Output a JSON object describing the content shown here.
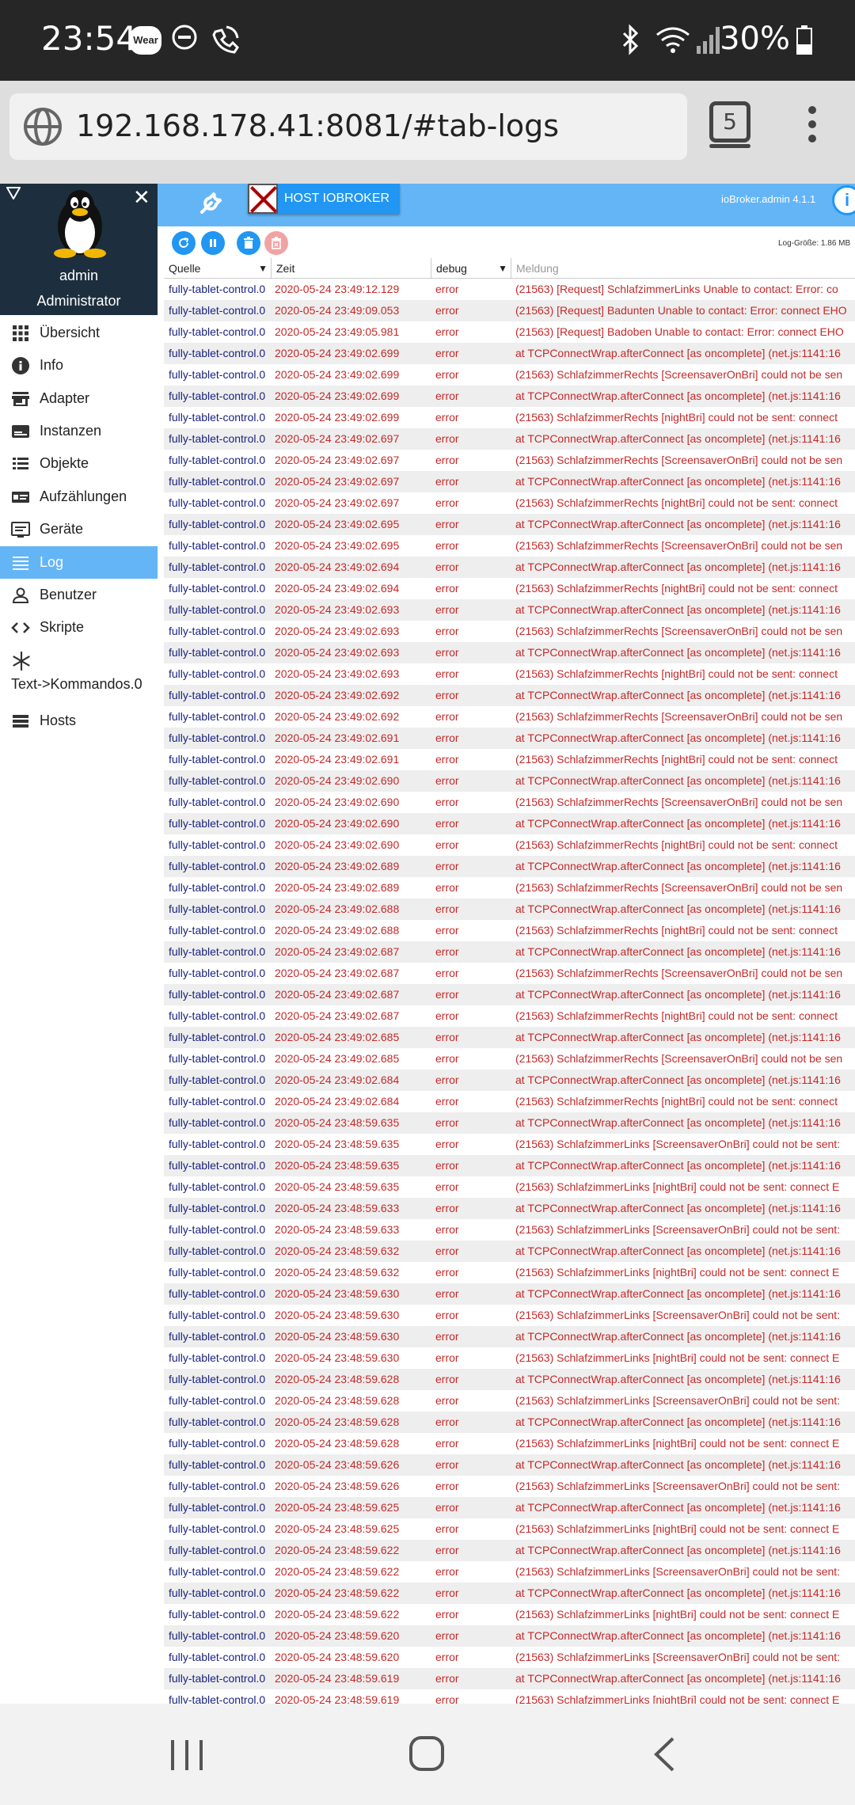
{
  "status_bar": {
    "time": "23:54",
    "wear_badge": "Wear",
    "battery": "30%",
    "icons": [
      "dnd-icon",
      "wifi-calling-icon",
      "bluetooth-icon",
      "wifi-icon",
      "signal-icon",
      "battery-icon"
    ]
  },
  "browser": {
    "url": "192.168.178.41:8081/#tab-logs",
    "tab_count": "5"
  },
  "sidebar": {
    "user_name": "admin",
    "user_role": "Administrator",
    "close_glyph": "✕",
    "items": [
      {
        "label": "Übersicht",
        "icon": "grid-icon"
      },
      {
        "label": "Info",
        "icon": "info-icon"
      },
      {
        "label": "Adapter",
        "icon": "store-icon"
      },
      {
        "label": "Instanzen",
        "icon": "instances-icon"
      },
      {
        "label": "Objekte",
        "icon": "list-icon"
      },
      {
        "label": "Aufzählungen",
        "icon": "enum-icon"
      },
      {
        "label": "Geräte",
        "icon": "devices-icon"
      },
      {
        "label": "Log",
        "icon": "log-icon",
        "active": true
      },
      {
        "label": "Benutzer",
        "icon": "user-icon"
      },
      {
        "label": "Skripte",
        "icon": "code-icon"
      },
      {
        "label": "Text->Kommandos.0",
        "icon": "snowflake-icon"
      },
      {
        "label": "Hosts",
        "icon": "hosts-icon"
      }
    ]
  },
  "topnav": {
    "host_label": "HOST IOBROKER",
    "version": "ioBroker.admin 4.1.1",
    "info_glyph": "i"
  },
  "toolbar": {
    "log_size": "Log-Größe: 1.86 MB"
  },
  "table": {
    "headers": {
      "source": "Quelle",
      "time": "Zeit",
      "severity": "debug",
      "message_placeholder": "Meldung"
    },
    "rows": [
      {
        "source": "fully-tablet-control.0",
        "time": "2020-05-24 23:49:12.129",
        "severity": "error",
        "message": "(21563) [Request] SchlafzimmerLinks Unable to contact: Error: co"
      },
      {
        "source": "fully-tablet-control.0",
        "time": "2020-05-24 23:49:09.053",
        "severity": "error",
        "message": "(21563) [Request] Badunten Unable to contact: Error: connect EHO"
      },
      {
        "source": "fully-tablet-control.0",
        "time": "2020-05-24 23:49:05.981",
        "severity": "error",
        "message": "(21563) [Request] Badoben Unable to contact: Error: connect EHO"
      },
      {
        "source": "fully-tablet-control.0",
        "time": "2020-05-24 23:49:02.699",
        "severity": "error",
        "message": "at TCPConnectWrap.afterConnect [as oncomplete] (net.js:1141:16"
      },
      {
        "source": "fully-tablet-control.0",
        "time": "2020-05-24 23:49:02.699",
        "severity": "error",
        "message": "(21563) SchlafzimmerRechts [ScreensaverOnBri] could not be sen"
      },
      {
        "source": "fully-tablet-control.0",
        "time": "2020-05-24 23:49:02.699",
        "severity": "error",
        "message": "at TCPConnectWrap.afterConnect [as oncomplete] (net.js:1141:16"
      },
      {
        "source": "fully-tablet-control.0",
        "time": "2020-05-24 23:49:02.699",
        "severity": "error",
        "message": "(21563) SchlafzimmerRechts [nightBri] could not be sent: connect"
      },
      {
        "source": "fully-tablet-control.0",
        "time": "2020-05-24 23:49:02.697",
        "severity": "error",
        "message": "at TCPConnectWrap.afterConnect [as oncomplete] (net.js:1141:16"
      },
      {
        "source": "fully-tablet-control.0",
        "time": "2020-05-24 23:49:02.697",
        "severity": "error",
        "message": "(21563) SchlafzimmerRechts [ScreensaverOnBri] could not be sen"
      },
      {
        "source": "fully-tablet-control.0",
        "time": "2020-05-24 23:49:02.697",
        "severity": "error",
        "message": "at TCPConnectWrap.afterConnect [as oncomplete] (net.js:1141:16"
      },
      {
        "source": "fully-tablet-control.0",
        "time": "2020-05-24 23:49:02.697",
        "severity": "error",
        "message": "(21563) SchlafzimmerRechts [nightBri] could not be sent: connect"
      },
      {
        "source": "fully-tablet-control.0",
        "time": "2020-05-24 23:49:02.695",
        "severity": "error",
        "message": "at TCPConnectWrap.afterConnect [as oncomplete] (net.js:1141:16"
      },
      {
        "source": "fully-tablet-control.0",
        "time": "2020-05-24 23:49:02.695",
        "severity": "error",
        "message": "(21563) SchlafzimmerRechts [ScreensaverOnBri] could not be sen"
      },
      {
        "source": "fully-tablet-control.0",
        "time": "2020-05-24 23:49:02.694",
        "severity": "error",
        "message": "at TCPConnectWrap.afterConnect [as oncomplete] (net.js:1141:16"
      },
      {
        "source": "fully-tablet-control.0",
        "time": "2020-05-24 23:49:02.694",
        "severity": "error",
        "message": "(21563) SchlafzimmerRechts [nightBri] could not be sent: connect"
      },
      {
        "source": "fully-tablet-control.0",
        "time": "2020-05-24 23:49:02.693",
        "severity": "error",
        "message": "at TCPConnectWrap.afterConnect [as oncomplete] (net.js:1141:16"
      },
      {
        "source": "fully-tablet-control.0",
        "time": "2020-05-24 23:49:02.693",
        "severity": "error",
        "message": "(21563) SchlafzimmerRechts [ScreensaverOnBri] could not be sen"
      },
      {
        "source": "fully-tablet-control.0",
        "time": "2020-05-24 23:49:02.693",
        "severity": "error",
        "message": "at TCPConnectWrap.afterConnect [as oncomplete] (net.js:1141:16"
      },
      {
        "source": "fully-tablet-control.0",
        "time": "2020-05-24 23:49:02.693",
        "severity": "error",
        "message": "(21563) SchlafzimmerRechts [nightBri] could not be sent: connect"
      },
      {
        "source": "fully-tablet-control.0",
        "time": "2020-05-24 23:49:02.692",
        "severity": "error",
        "message": "at TCPConnectWrap.afterConnect [as oncomplete] (net.js:1141:16"
      },
      {
        "source": "fully-tablet-control.0",
        "time": "2020-05-24 23:49:02.692",
        "severity": "error",
        "message": "(21563) SchlafzimmerRechts [ScreensaverOnBri] could not be sen"
      },
      {
        "source": "fully-tablet-control.0",
        "time": "2020-05-24 23:49:02.691",
        "severity": "error",
        "message": "at TCPConnectWrap.afterConnect [as oncomplete] (net.js:1141:16"
      },
      {
        "source": "fully-tablet-control.0",
        "time": "2020-05-24 23:49:02.691",
        "severity": "error",
        "message": "(21563) SchlafzimmerRechts [nightBri] could not be sent: connect"
      },
      {
        "source": "fully-tablet-control.0",
        "time": "2020-05-24 23:49:02.690",
        "severity": "error",
        "message": "at TCPConnectWrap.afterConnect [as oncomplete] (net.js:1141:16"
      },
      {
        "source": "fully-tablet-control.0",
        "time": "2020-05-24 23:49:02.690",
        "severity": "error",
        "message": "(21563) SchlafzimmerRechts [ScreensaverOnBri] could not be sen"
      },
      {
        "source": "fully-tablet-control.0",
        "time": "2020-05-24 23:49:02.690",
        "severity": "error",
        "message": "at TCPConnectWrap.afterConnect [as oncomplete] (net.js:1141:16"
      },
      {
        "source": "fully-tablet-control.0",
        "time": "2020-05-24 23:49:02.690",
        "severity": "error",
        "message": "(21563) SchlafzimmerRechts [nightBri] could not be sent: connect"
      },
      {
        "source": "fully-tablet-control.0",
        "time": "2020-05-24 23:49:02.689",
        "severity": "error",
        "message": "at TCPConnectWrap.afterConnect [as oncomplete] (net.js:1141:16"
      },
      {
        "source": "fully-tablet-control.0",
        "time": "2020-05-24 23:49:02.689",
        "severity": "error",
        "message": "(21563) SchlafzimmerRechts [ScreensaverOnBri] could not be sen"
      },
      {
        "source": "fully-tablet-control.0",
        "time": "2020-05-24 23:49:02.688",
        "severity": "error",
        "message": "at TCPConnectWrap.afterConnect [as oncomplete] (net.js:1141:16"
      },
      {
        "source": "fully-tablet-control.0",
        "time": "2020-05-24 23:49:02.688",
        "severity": "error",
        "message": "(21563) SchlafzimmerRechts [nightBri] could not be sent: connect"
      },
      {
        "source": "fully-tablet-control.0",
        "time": "2020-05-24 23:49:02.687",
        "severity": "error",
        "message": "at TCPConnectWrap.afterConnect [as oncomplete] (net.js:1141:16"
      },
      {
        "source": "fully-tablet-control.0",
        "time": "2020-05-24 23:49:02.687",
        "severity": "error",
        "message": "(21563) SchlafzimmerRechts [ScreensaverOnBri] could not be sen"
      },
      {
        "source": "fully-tablet-control.0",
        "time": "2020-05-24 23:49:02.687",
        "severity": "error",
        "message": "at TCPConnectWrap.afterConnect [as oncomplete] (net.js:1141:16"
      },
      {
        "source": "fully-tablet-control.0",
        "time": "2020-05-24 23:49:02.687",
        "severity": "error",
        "message": "(21563) SchlafzimmerRechts [nightBri] could not be sent: connect"
      },
      {
        "source": "fully-tablet-control.0",
        "time": "2020-05-24 23:49:02.685",
        "severity": "error",
        "message": "at TCPConnectWrap.afterConnect [as oncomplete] (net.js:1141:16"
      },
      {
        "source": "fully-tablet-control.0",
        "time": "2020-05-24 23:49:02.685",
        "severity": "error",
        "message": "(21563) SchlafzimmerRechts [ScreensaverOnBri] could not be sen"
      },
      {
        "source": "fully-tablet-control.0",
        "time": "2020-05-24 23:49:02.684",
        "severity": "error",
        "message": "at TCPConnectWrap.afterConnect [as oncomplete] (net.js:1141:16"
      },
      {
        "source": "fully-tablet-control.0",
        "time": "2020-05-24 23:49:02.684",
        "severity": "error",
        "message": "(21563) SchlafzimmerRechts [nightBri] could not be sent: connect"
      },
      {
        "source": "fully-tablet-control.0",
        "time": "2020-05-24 23:48:59.635",
        "severity": "error",
        "message": "at TCPConnectWrap.afterConnect [as oncomplete] (net.js:1141:16"
      },
      {
        "source": "fully-tablet-control.0",
        "time": "2020-05-24 23:48:59.635",
        "severity": "error",
        "message": "(21563) SchlafzimmerLinks [ScreensaverOnBri] could not be sent:"
      },
      {
        "source": "fully-tablet-control.0",
        "time": "2020-05-24 23:48:59.635",
        "severity": "error",
        "message": "at TCPConnectWrap.afterConnect [as oncomplete] (net.js:1141:16"
      },
      {
        "source": "fully-tablet-control.0",
        "time": "2020-05-24 23:48:59.635",
        "severity": "error",
        "message": "(21563) SchlafzimmerLinks [nightBri] could not be sent: connect E"
      },
      {
        "source": "fully-tablet-control.0",
        "time": "2020-05-24 23:48:59.633",
        "severity": "error",
        "message": "at TCPConnectWrap.afterConnect [as oncomplete] (net.js:1141:16"
      },
      {
        "source": "fully-tablet-control.0",
        "time": "2020-05-24 23:48:59.633",
        "severity": "error",
        "message": "(21563) SchlafzimmerLinks [ScreensaverOnBri] could not be sent:"
      },
      {
        "source": "fully-tablet-control.0",
        "time": "2020-05-24 23:48:59.632",
        "severity": "error",
        "message": "at TCPConnectWrap.afterConnect [as oncomplete] (net.js:1141:16"
      },
      {
        "source": "fully-tablet-control.0",
        "time": "2020-05-24 23:48:59.632",
        "severity": "error",
        "message": "(21563) SchlafzimmerLinks [nightBri] could not be sent: connect E"
      },
      {
        "source": "fully-tablet-control.0",
        "time": "2020-05-24 23:48:59.630",
        "severity": "error",
        "message": "at TCPConnectWrap.afterConnect [as oncomplete] (net.js:1141:16"
      },
      {
        "source": "fully-tablet-control.0",
        "time": "2020-05-24 23:48:59.630",
        "severity": "error",
        "message": "(21563) SchlafzimmerLinks [ScreensaverOnBri] could not be sent:"
      },
      {
        "source": "fully-tablet-control.0",
        "time": "2020-05-24 23:48:59.630",
        "severity": "error",
        "message": "at TCPConnectWrap.afterConnect [as oncomplete] (net.js:1141:16"
      },
      {
        "source": "fully-tablet-control.0",
        "time": "2020-05-24 23:48:59.630",
        "severity": "error",
        "message": "(21563) SchlafzimmerLinks [nightBri] could not be sent: connect E"
      },
      {
        "source": "fully-tablet-control.0",
        "time": "2020-05-24 23:48:59.628",
        "severity": "error",
        "message": "at TCPConnectWrap.afterConnect [as oncomplete] (net.js:1141:16"
      },
      {
        "source": "fully-tablet-control.0",
        "time": "2020-05-24 23:48:59.628",
        "severity": "error",
        "message": "(21563) SchlafzimmerLinks [ScreensaverOnBri] could not be sent:"
      },
      {
        "source": "fully-tablet-control.0",
        "time": "2020-05-24 23:48:59.628",
        "severity": "error",
        "message": "at TCPConnectWrap.afterConnect [as oncomplete] (net.js:1141:16"
      },
      {
        "source": "fully-tablet-control.0",
        "time": "2020-05-24 23:48:59.628",
        "severity": "error",
        "message": "(21563) SchlafzimmerLinks [nightBri] could not be sent: connect E"
      },
      {
        "source": "fully-tablet-control.0",
        "time": "2020-05-24 23:48:59.626",
        "severity": "error",
        "message": "at TCPConnectWrap.afterConnect [as oncomplete] (net.js:1141:16"
      },
      {
        "source": "fully-tablet-control.0",
        "time": "2020-05-24 23:48:59.626",
        "severity": "error",
        "message": "(21563) SchlafzimmerLinks [ScreensaverOnBri] could not be sent:"
      },
      {
        "source": "fully-tablet-control.0",
        "time": "2020-05-24 23:48:59.625",
        "severity": "error",
        "message": "at TCPConnectWrap.afterConnect [as oncomplete] (net.js:1141:16"
      },
      {
        "source": "fully-tablet-control.0",
        "time": "2020-05-24 23:48:59.625",
        "severity": "error",
        "message": "(21563) SchlafzimmerLinks [nightBri] could not be sent: connect E"
      },
      {
        "source": "fully-tablet-control.0",
        "time": "2020-05-24 23:48:59.622",
        "severity": "error",
        "message": "at TCPConnectWrap.afterConnect [as oncomplete] (net.js:1141:16"
      },
      {
        "source": "fully-tablet-control.0",
        "time": "2020-05-24 23:48:59.622",
        "severity": "error",
        "message": "(21563) SchlafzimmerLinks [ScreensaverOnBri] could not be sent:"
      },
      {
        "source": "fully-tablet-control.0",
        "time": "2020-05-24 23:48:59.622",
        "severity": "error",
        "message": "at TCPConnectWrap.afterConnect [as oncomplete] (net.js:1141:16"
      },
      {
        "source": "fully-tablet-control.0",
        "time": "2020-05-24 23:48:59.622",
        "severity": "error",
        "message": "(21563) SchlafzimmerLinks [nightBri] could not be sent: connect E"
      },
      {
        "source": "fully-tablet-control.0",
        "time": "2020-05-24 23:48:59.620",
        "severity": "error",
        "message": "at TCPConnectWrap.afterConnect [as oncomplete] (net.js:1141:16"
      },
      {
        "source": "fully-tablet-control.0",
        "time": "2020-05-24 23:48:59.620",
        "severity": "error",
        "message": "(21563) SchlafzimmerLinks [ScreensaverOnBri] could not be sent:"
      },
      {
        "source": "fully-tablet-control.0",
        "time": "2020-05-24 23:48:59.619",
        "severity": "error",
        "message": "at TCPConnectWrap.afterConnect [as oncomplete] (net.js:1141:16"
      },
      {
        "source": "fully-tablet-control.0",
        "time": "2020-05-24 23:48:59.619",
        "severity": "error",
        "message": "(21563) SchlafzimmerLinks [nightBri] could not be sent: connect E"
      }
    ]
  }
}
